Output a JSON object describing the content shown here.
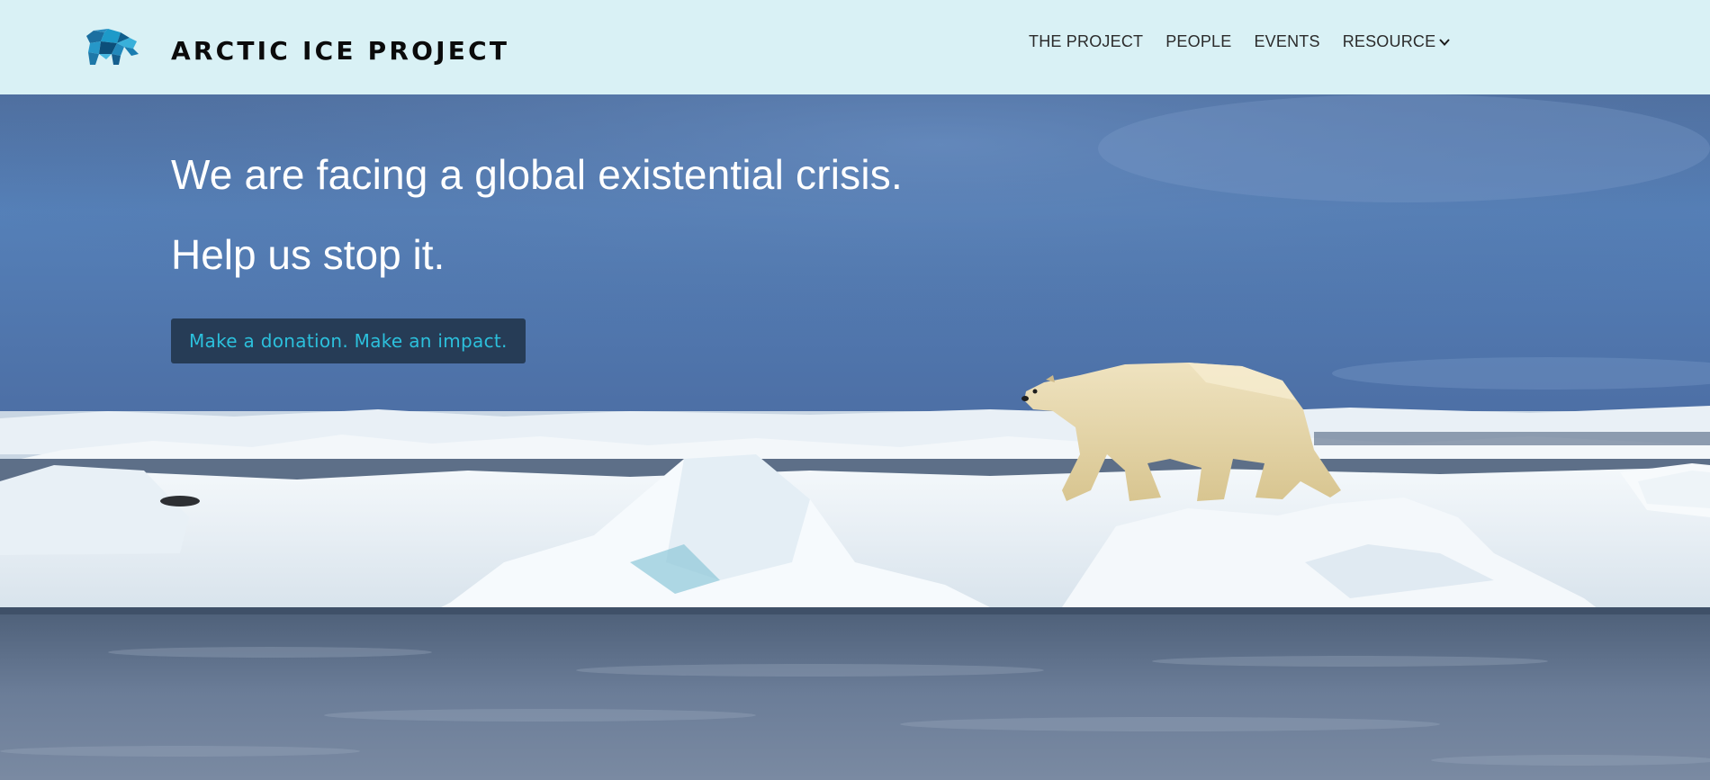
{
  "header": {
    "brand_name": "ARCTIC ICE PROJECT",
    "logo_icon": "polar-bear-logo-icon",
    "background_color": "#d9f1f5",
    "nav": {
      "items": [
        {
          "label": "THE PROJECT"
        },
        {
          "label": "PEOPLE"
        },
        {
          "label": "EVENTS"
        },
        {
          "label": "RESOURCE",
          "icon": "chevron-down-icon"
        }
      ]
    }
  },
  "hero": {
    "headline": "We are facing a global existential crisis.",
    "subheadline": "Help us stop it.",
    "cta_label": "Make a donation. Make an impact.",
    "cta_background": "#263c56",
    "cta_text_color": "#2cc0dc",
    "image_subject": "polar bear walking on sea ice"
  }
}
